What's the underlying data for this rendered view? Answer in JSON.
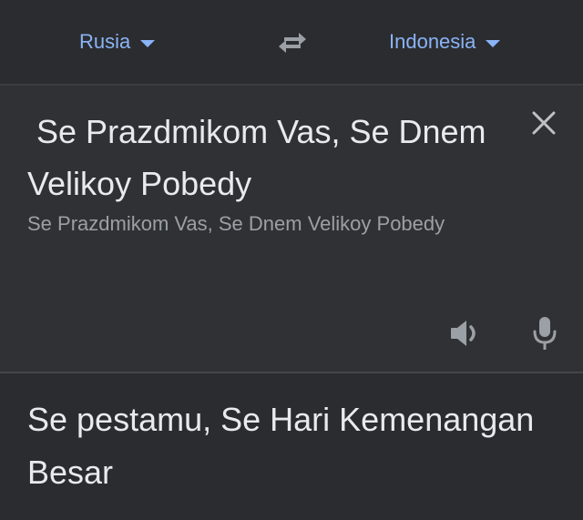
{
  "languages": {
    "source": "Rusia",
    "target": "Indonesia"
  },
  "input": {
    "text": " Se Prazdmikom Vas, Se Dnem Velikoy Pobedy",
    "transliteration": "Se Prazdmikom Vas, Se Dnem Velikoy Pobedy"
  },
  "output": {
    "text": "Se pestamu, Se Hari Kemenangan Besar"
  },
  "icons": {
    "swap": "swap-arrows-icon",
    "close": "close-icon",
    "speaker": "speaker-icon",
    "mic": "microphone-icon",
    "dropdown": "caret-down-icon"
  },
  "colors": {
    "accent": "#8ab4f8",
    "text_primary": "#e8eaed",
    "text_secondary": "#9aa0a6",
    "background": "#2b2c2f",
    "panel": "#303134"
  }
}
